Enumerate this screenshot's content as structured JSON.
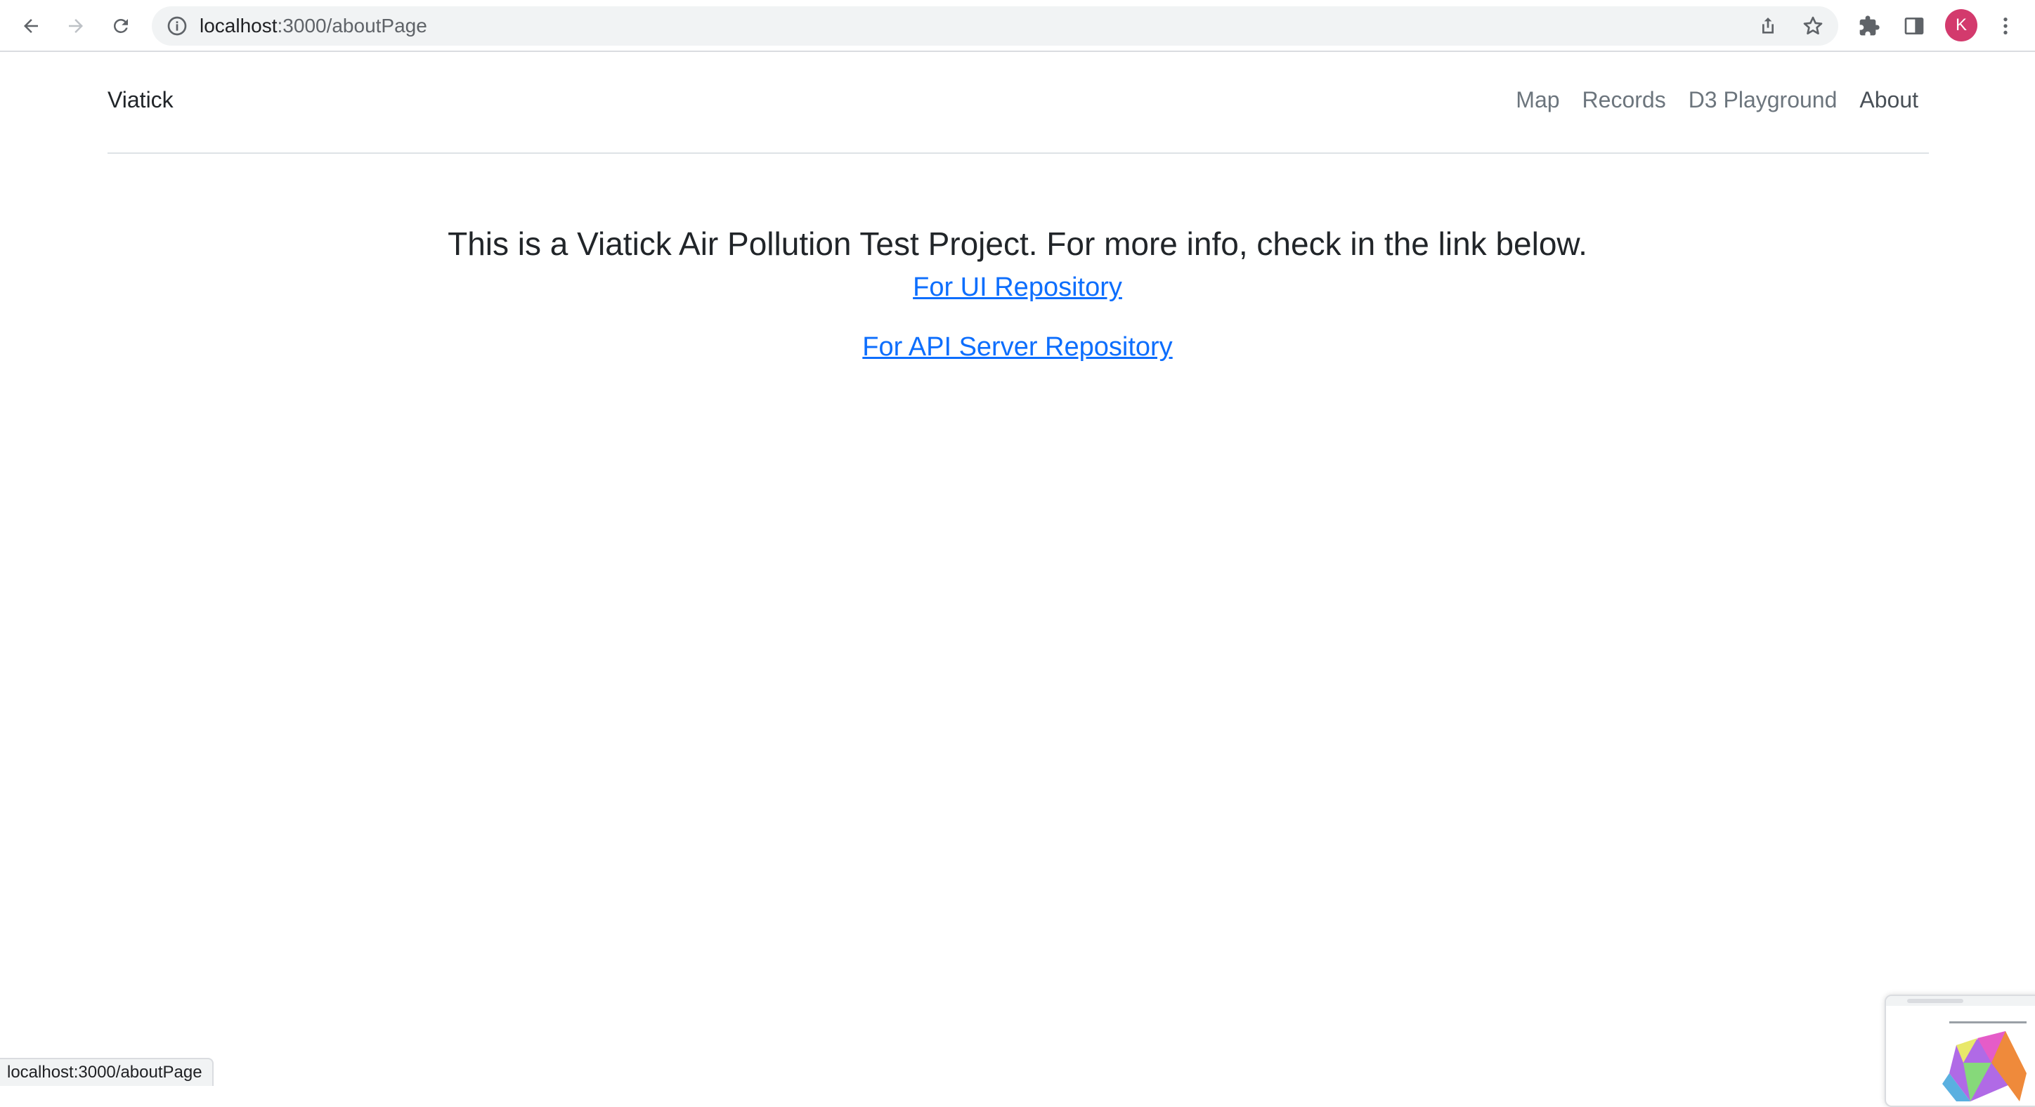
{
  "browser": {
    "url_host": "localhost",
    "url_path": ":3000/aboutPage",
    "avatar_letter": "K",
    "avatar_color": "#d33a6d"
  },
  "navbar": {
    "brand": "Viatick",
    "links": [
      {
        "label": "Map"
      },
      {
        "label": "Records"
      },
      {
        "label": "D3 Playground"
      },
      {
        "label": "About"
      }
    ]
  },
  "main": {
    "headline": "This is a Viatick Air Pollution Test Project. For more info, check in the link below.",
    "ui_link": "For UI Repository",
    "api_link": "For API Server Repository"
  },
  "status_bar": {
    "text": "localhost:3000/aboutPage"
  },
  "colors": {
    "link": "#0d6efd",
    "nav_link": "#6c757d",
    "text": "#212529"
  }
}
